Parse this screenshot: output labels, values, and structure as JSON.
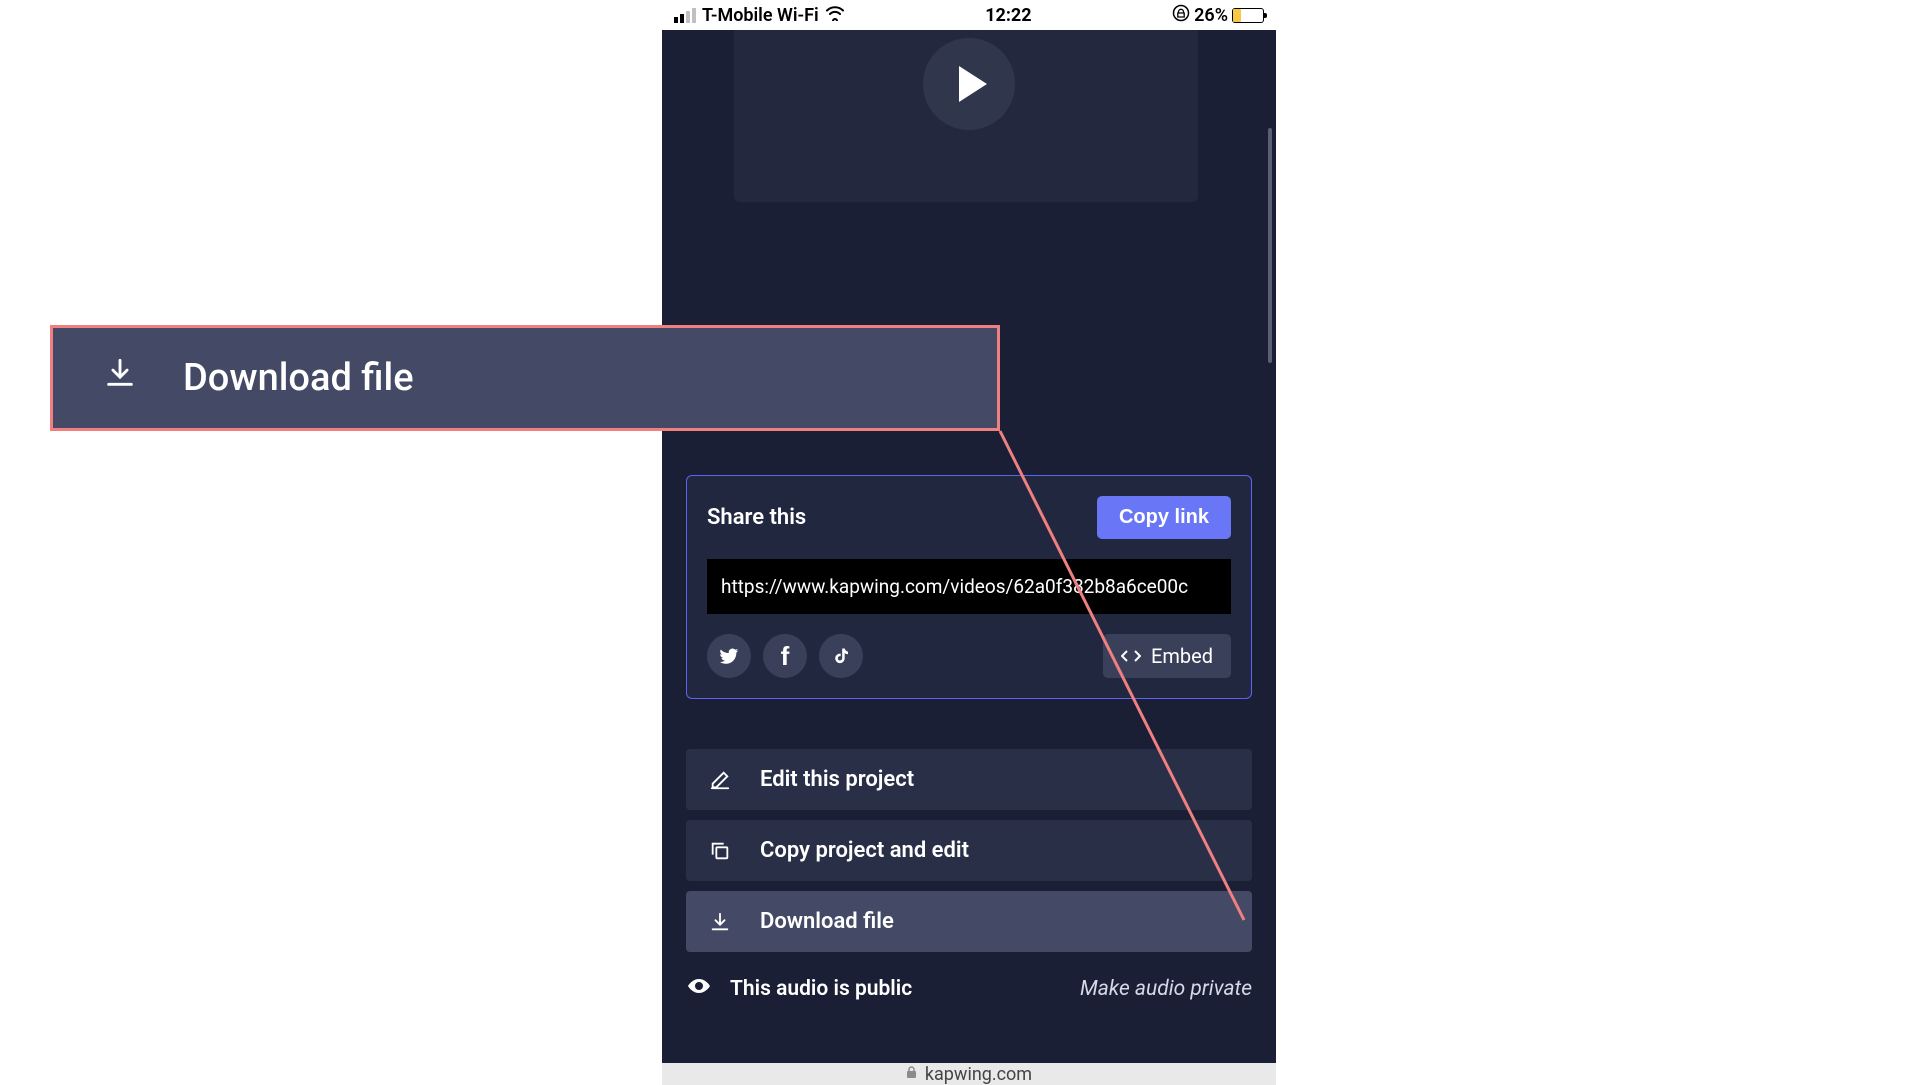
{
  "status_bar": {
    "carrier": "T-Mobile Wi-Fi",
    "time": "12:22",
    "battery_pct": "26%"
  },
  "share": {
    "title": "Share this",
    "copy_link": "Copy link",
    "url": "https://www.kapwing.com/videos/62a0f382b8a6ce00c",
    "embed": "Embed"
  },
  "actions": {
    "edit": "Edit this project",
    "copy_edit": "Copy project and edit",
    "download": "Download file"
  },
  "privacy": {
    "status": "This audio is public",
    "toggle": "Make audio private"
  },
  "browser": {
    "domain": "kapwing.com"
  },
  "callout": {
    "label": "Download file"
  }
}
